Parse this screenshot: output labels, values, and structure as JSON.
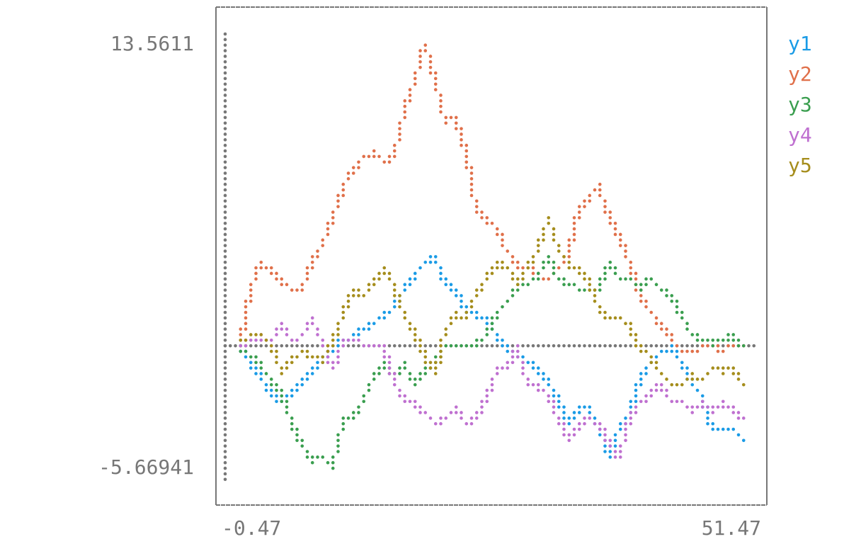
{
  "chart_data": {
    "type": "scatter",
    "title": "",
    "xlabel": "",
    "ylabel": "",
    "xlim": [
      -0.47,
      51.47
    ],
    "ylim": [
      -5.66941,
      13.5611
    ],
    "x_tick_labels": [
      "-0.47",
      "51.47"
    ],
    "y_tick_labels": [
      "13.5611",
      "-5.66941"
    ],
    "grid": false,
    "legend_placement": "right",
    "x": [
      1,
      2,
      3,
      4,
      5,
      6,
      7,
      8,
      9,
      10,
      11,
      12,
      13,
      14,
      15,
      16,
      17,
      18,
      19,
      20,
      21,
      22,
      23,
      24,
      25,
      26,
      27,
      28,
      29,
      30,
      31,
      32,
      33,
      34,
      35,
      36,
      37,
      38,
      39,
      40,
      41,
      42,
      43,
      44,
      45,
      46,
      47,
      48,
      49,
      50
    ],
    "series": [
      {
        "name": "y1",
        "color": "#1a9be6",
        "values": [
          0,
          -0.7,
          -1.3,
          -2.0,
          -2.3,
          -2.0,
          -1.5,
          -1.0,
          -0.5,
          0,
          0.3,
          0.5,
          0.8,
          1.0,
          1.4,
          1.7,
          2.6,
          3.2,
          3.7,
          3.9,
          2.9,
          2.5,
          1.7,
          1.5,
          1.2,
          0.5,
          0,
          -0.3,
          -0.5,
          -1.0,
          -1.5,
          -2.2,
          -3.2,
          -2.6,
          -2.6,
          -3.5,
          -4.6,
          -3.5,
          -2.8,
          -1.3,
          -0.7,
          -0.2,
          0,
          -0.5,
          -1.5,
          -2.0,
          -3.4,
          -3.4,
          -3.4,
          -3.9
        ]
      },
      {
        "name": "y2",
        "color": "#e0704a",
        "values": [
          0.2,
          2.6,
          3.7,
          3.4,
          2.9,
          2.6,
          2.6,
          3.8,
          4.5,
          5.7,
          6.9,
          7.7,
          8.3,
          8.4,
          8.1,
          8.2,
          10.3,
          11.5,
          13.2,
          11.5,
          9.7,
          10.0,
          8.5,
          6.0,
          5.5,
          5.2,
          4.2,
          3.6,
          3.5,
          3.2,
          3.0,
          3.5,
          4.0,
          6.0,
          6.5,
          7.0,
          5.7,
          4.8,
          3.7,
          2.3,
          1.6,
          1.1,
          0.5,
          -0.1,
          -0.2,
          0,
          0.1,
          -0.1,
          0.2,
          0
        ]
      },
      {
        "name": "y3",
        "color": "#3a9e4f",
        "values": [
          0,
          -0.3,
          -0.8,
          -1.4,
          -2.0,
          -3.2,
          -4.1,
          -4.9,
          -4.7,
          -5.2,
          -3.2,
          -2.9,
          -2.3,
          -1.3,
          -0.7,
          -1.2,
          -0.7,
          -1.5,
          -0.9,
          -0.7,
          0.2,
          0.2,
          0.2,
          0.2,
          0.5,
          1.5,
          2.0,
          2.6,
          2.8,
          3.0,
          4.0,
          3.0,
          2.8,
          2.6,
          2.4,
          2.6,
          3.6,
          3.1,
          3.0,
          2.6,
          3.1,
          2.6,
          2.3,
          1.4,
          0.6,
          0.4,
          0.2,
          0.4,
          0.5,
          0
        ]
      },
      {
        "name": "y4",
        "color": "#bf70d0",
        "values": [
          0,
          0.3,
          0.5,
          0.2,
          1.1,
          0.3,
          0.5,
          1.2,
          0.2,
          -0.8,
          0.2,
          0.4,
          0.2,
          0.1,
          0,
          -1.4,
          -2.2,
          -2.4,
          -2.8,
          -3.3,
          -3.0,
          -2.6,
          -3.3,
          -3.0,
          -2.2,
          -1.0,
          -0.8,
          0,
          -1.5,
          -1.6,
          -2.0,
          -3.0,
          -3.9,
          -3.4,
          -3.0,
          -3.3,
          -4.1,
          -4.7,
          -3.0,
          -2.4,
          -2.1,
          -1.5,
          -2.2,
          -2.3,
          -2.7,
          -2.4,
          -2.7,
          -2.4,
          -2.6,
          -3.0
        ]
      },
      {
        "name": "y5",
        "color": "#a58d1c",
        "values": [
          0.3,
          0.5,
          0.6,
          0.2,
          -1.0,
          -0.5,
          -0.2,
          -0.3,
          -0.5,
          0.3,
          1.5,
          2.5,
          2.3,
          2.8,
          3.5,
          2.7,
          1.5,
          0.6,
          -0.3,
          -1.2,
          0.8,
          1.5,
          1.3,
          2.3,
          3.0,
          3.7,
          3.5,
          2.8,
          3.5,
          4.2,
          5.6,
          4.3,
          3.6,
          3.4,
          2.8,
          1.8,
          1.2,
          1.3,
          1.0,
          0,
          -0.3,
          -1.1,
          -1.5,
          -1.6,
          -1.2,
          -1.4,
          -0.9,
          -1.0,
          -0.9,
          -1.5
        ]
      }
    ],
    "axis_color": "#777777"
  }
}
